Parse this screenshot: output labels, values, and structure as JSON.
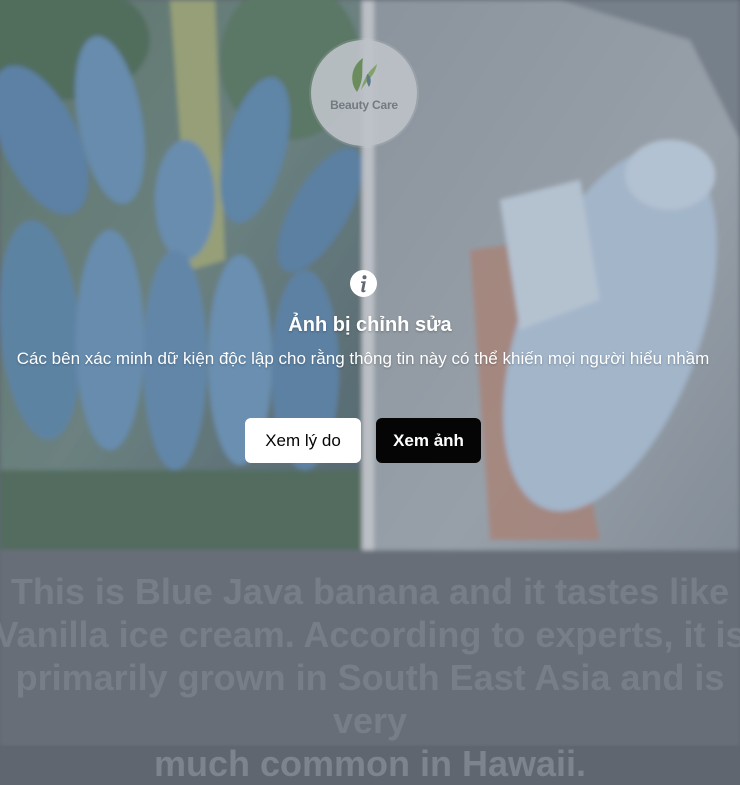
{
  "background_image": {
    "description_icon": "blue-java-banana-photo",
    "logo": {
      "brand": "Beauty Care",
      "tagline": "",
      "icon": "leaf-face-icon"
    },
    "caption_text": "This is Blue Java banana and it tastes like\nVanilla ice cream. According to experts, it is\nprimarily grown in South East Asia and is very\nmuch common in Hawaii."
  },
  "warning": {
    "icon": "info-icon",
    "title": "Ảnh bị chỉnh sửa",
    "message": "Các bên xác minh dữ kiện độc lập cho rằng thông tin này có thể khiến mọi người hiểu nhầm"
  },
  "buttons": {
    "see_why": "Xem lý do",
    "see_photo": "Xem ảnh"
  },
  "colors": {
    "overlay": "#5f6874",
    "button_light_bg": "#ffffff",
    "button_dark_bg": "#050505"
  }
}
